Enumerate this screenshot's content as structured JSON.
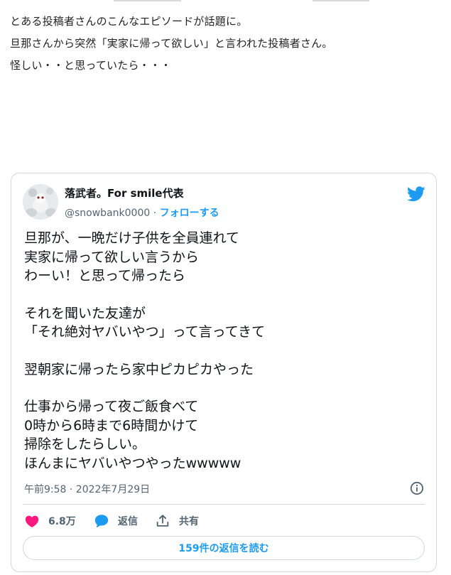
{
  "intro": {
    "lines": [
      "とある投稿者さんのこんなエピソードが話題に。",
      "旦那さんから突然「実家に帰って欲しい」と言われた投稿者さん。",
      "怪しい・・と思っていたら・・・"
    ]
  },
  "tweet": {
    "user_name": "落武者。For smile代表",
    "handle": "@snowbank0000",
    "separator": " · ",
    "follow_label": "フォローする",
    "body_paragraphs": [
      [
        "旦那が、一晩だけ子供を全員連れて",
        "実家に帰って欲しい言うから",
        "わーい！と思って帰ったら"
      ],
      [
        "それを聞いた友達が",
        "「それ絶対ヤバいやつ」って言ってきて"
      ],
      [
        "翌朝家に帰ったら家中ピカピカやった"
      ],
      [
        "仕事から帰って夜ご飯食べて",
        "0時から6時まで6時間かけて",
        "掃除をしたらしい。",
        "ほんまにヤバいやつやったwwwww"
      ]
    ],
    "timestamp": "午前9:58 · 2022年7月29日",
    "actions": {
      "like_count": "6.8万",
      "reply_label": "返信",
      "share_label": "共有"
    },
    "read_replies_label": "159件の返信を読む"
  },
  "icons": {
    "bird": "twitter-bird-icon",
    "info": "info-icon",
    "heart": "heart-icon",
    "reply": "reply-bubble-icon",
    "share": "share-icon"
  },
  "colors": {
    "accent": "#1d9bf0",
    "heart": "#f91880",
    "text": "#0f1419",
    "muted": "#536471",
    "border": "#cfd9de"
  }
}
